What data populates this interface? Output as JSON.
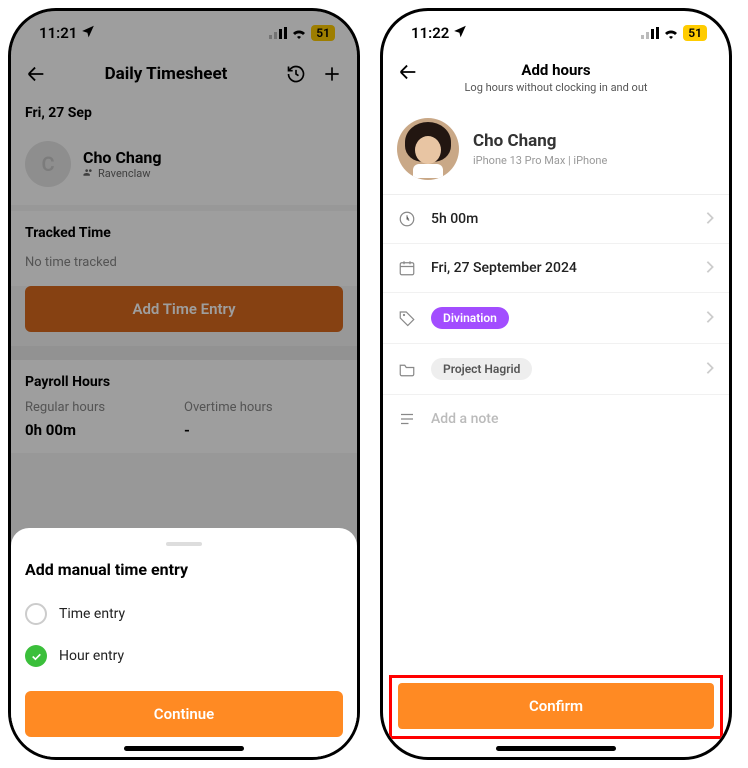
{
  "status": {
    "time_left": "11:21",
    "time_right": "11:22",
    "battery": "51"
  },
  "p1": {
    "header": {
      "title": "Daily Timesheet"
    },
    "date": "Fri, 27 Sep",
    "user": {
      "initial": "C",
      "name": "Cho Chang",
      "team": "Ravenclaw"
    },
    "tracked": {
      "title": "Tracked Time",
      "empty": "No time tracked",
      "add_btn": "Add Time Entry"
    },
    "payroll": {
      "title": "Payroll Hours",
      "regular_label": "Regular hours",
      "regular_value": "0h 00m",
      "overtime_label": "Overtime hours",
      "overtime_value": "-"
    },
    "sheet": {
      "title": "Add manual time entry",
      "option_time": "Time entry",
      "option_hour": "Hour entry",
      "continue": "Continue"
    }
  },
  "p2": {
    "header": {
      "title": "Add hours",
      "subtitle": "Log hours without clocking in and out"
    },
    "user": {
      "name": "Cho Chang",
      "device": "iPhone 13 Pro Max | iPhone"
    },
    "rows": {
      "duration": "5h 00m",
      "date": "Fri, 27 September 2024",
      "tag": "Divination",
      "project": "Project Hagrid",
      "note_placeholder": "Add a note"
    },
    "confirm": "Confirm"
  }
}
